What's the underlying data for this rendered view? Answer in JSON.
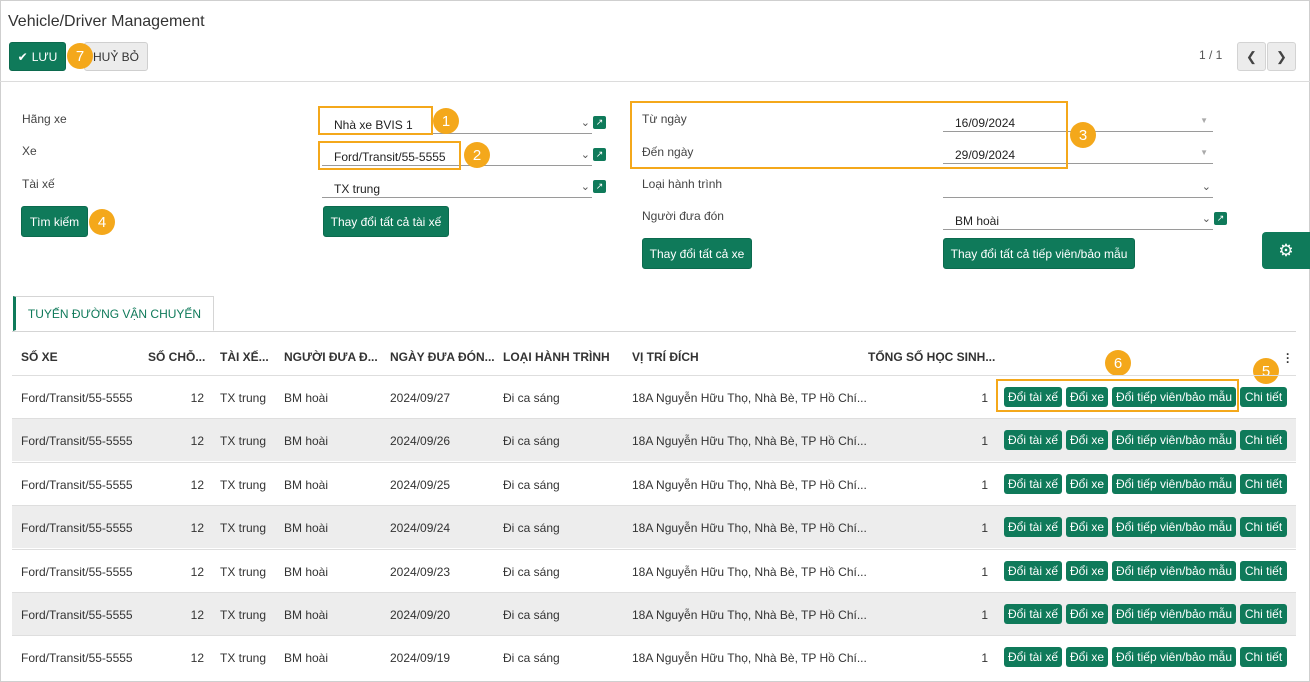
{
  "window": {
    "title": "Vehicle/Driver Management"
  },
  "toolbar": {
    "save_label": "LƯU",
    "cancel_label": "HUỶ BỎ",
    "pager": "1 / 1"
  },
  "form": {
    "hang_xe": {
      "label": "Hãng xe",
      "value": "Nhà xe BVIS 1"
    },
    "xe": {
      "label": "Xe",
      "value": "Ford/Transit/55-5555"
    },
    "tai_xe": {
      "label": "Tài xế",
      "value": "TX trung"
    },
    "search_label": "Tìm kiếm",
    "change_all_drivers_label": "Thay đổi tất cả tài xế",
    "tu_ngay": {
      "label": "Từ ngày",
      "value": "16/09/2024"
    },
    "den_ngay": {
      "label": "Đến ngày",
      "value": "29/09/2024"
    },
    "loai_hanh_trinh": {
      "label": "Loại hành trình",
      "value": ""
    },
    "nguoi_dua_don": {
      "label": "Người đưa đón",
      "value": "BM hoài"
    },
    "change_all_vehicles_label": "Thay đổi tất cả xe",
    "change_all_attendants_label": "Thay đổi tất cả tiếp viên/bảo mẫu"
  },
  "badges": [
    "1",
    "2",
    "3",
    "4",
    "5",
    "6",
    "7"
  ],
  "tab": {
    "label": "TUYẾN ĐƯỜNG VẬN CHUYỂN"
  },
  "table": {
    "headers": [
      "SỐ XE",
      "SỐ CHỖ...",
      "TÀI XẾ...",
      "NGƯỜI ĐƯA Đ...",
      "NGÀY ĐƯA ĐÓN...",
      "LOẠI HÀNH TRÌNH",
      "VỊ TRÍ ĐÍCH",
      "TỔNG SỐ HỌC SINH..."
    ],
    "actions": {
      "change_driver": "Đổi tài xế",
      "change_vehicle": "Đổi xe",
      "change_attendant": "Đổi tiếp viên/bảo mẫu",
      "detail": "Chi tiết"
    },
    "rows": [
      {
        "so_xe": "Ford/Transit/55-5555",
        "so_cho": "12",
        "tai_xe": "TX trung",
        "nguoi_dua": "BM hoài",
        "ngay": "2024/09/27",
        "loai": "Đi ca sáng",
        "vi_tri": "18A Nguyễn Hữu Thọ, Nhà Bè, TP Hồ Chí...",
        "tong": "1"
      },
      {
        "so_xe": "Ford/Transit/55-5555",
        "so_cho": "12",
        "tai_xe": "TX trung",
        "nguoi_dua": "BM hoài",
        "ngay": "2024/09/26",
        "loai": "Đi ca sáng",
        "vi_tri": "18A Nguyễn Hữu Thọ, Nhà Bè, TP Hồ Chí...",
        "tong": "1"
      },
      {
        "so_xe": "Ford/Transit/55-5555",
        "so_cho": "12",
        "tai_xe": "TX trung",
        "nguoi_dua": "BM hoài",
        "ngay": "2024/09/25",
        "loai": "Đi ca sáng",
        "vi_tri": "18A Nguyễn Hữu Thọ, Nhà Bè, TP Hồ Chí...",
        "tong": "1"
      },
      {
        "so_xe": "Ford/Transit/55-5555",
        "so_cho": "12",
        "tai_xe": "TX trung",
        "nguoi_dua": "BM hoài",
        "ngay": "2024/09/24",
        "loai": "Đi ca sáng",
        "vi_tri": "18A Nguyễn Hữu Thọ, Nhà Bè, TP Hồ Chí...",
        "tong": "1"
      },
      {
        "so_xe": "Ford/Transit/55-5555",
        "so_cho": "12",
        "tai_xe": "TX trung",
        "nguoi_dua": "BM hoài",
        "ngay": "2024/09/23",
        "loai": "Đi ca sáng",
        "vi_tri": "18A Nguyễn Hữu Thọ, Nhà Bè, TP Hồ Chí...",
        "tong": "1"
      },
      {
        "so_xe": "Ford/Transit/55-5555",
        "so_cho": "12",
        "tai_xe": "TX trung",
        "nguoi_dua": "BM hoài",
        "ngay": "2024/09/20",
        "loai": "Đi ca sáng",
        "vi_tri": "18A Nguyễn Hữu Thọ, Nhà Bè, TP Hồ Chí...",
        "tong": "1"
      },
      {
        "so_xe": "Ford/Transit/55-5555",
        "so_cho": "12",
        "tai_xe": "TX trung",
        "nguoi_dua": "BM hoài",
        "ngay": "2024/09/19",
        "loai": "Đi ca sáng",
        "vi_tri": "18A Nguyễn Hữu Thọ, Nhà Bè, TP Hồ Chí...",
        "tong": "1"
      }
    ]
  },
  "colors": {
    "primary": "#0f7a5a",
    "highlight": "#f4a81b",
    "alt_row": "#ededed"
  },
  "icons": {
    "save": "check-icon",
    "prev": "chevron-left-icon",
    "next": "chevron-right-icon",
    "external": "external-link-icon",
    "settings": "gear-icon",
    "menu": "kebab-icon"
  }
}
